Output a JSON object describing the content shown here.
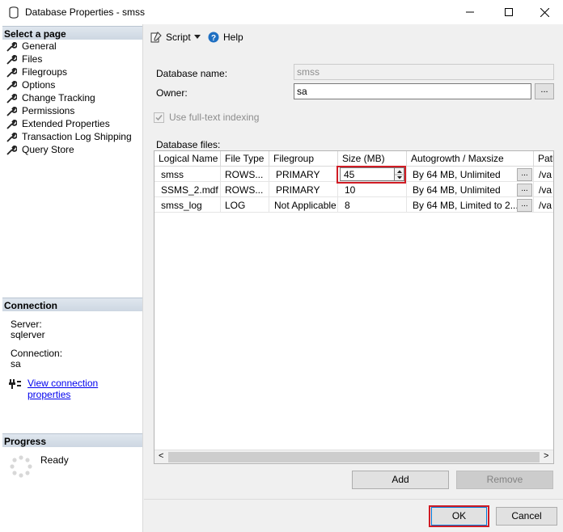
{
  "window": {
    "title": "Database Properties - smss",
    "minimize_glyph": "—",
    "maximize_glyph": "☐",
    "close_glyph": "✕"
  },
  "left_pane": {
    "select_page_header": "Select a page",
    "pages": [
      {
        "label": "General"
      },
      {
        "label": "Files",
        "selected": true
      },
      {
        "label": "Filegroups"
      },
      {
        "label": "Options"
      },
      {
        "label": "Change Tracking"
      },
      {
        "label": "Permissions"
      },
      {
        "label": "Extended Properties"
      },
      {
        "label": "Transaction Log Shipping"
      },
      {
        "label": "Query Store"
      }
    ],
    "connection_header": "Connection",
    "server_label": "Server:",
    "server_value": "sqlerver",
    "connection_label": "Connection:",
    "connection_value": "sa",
    "view_connection_link": "View connection properties",
    "progress_header": "Progress",
    "progress_status": "Ready"
  },
  "toolbar": {
    "script_label": "Script",
    "help_label": "Help"
  },
  "form": {
    "database_name_label": "Database name:",
    "database_name_value": "smss",
    "owner_label": "Owner:",
    "owner_value": "sa",
    "owner_browse": "...",
    "fulltext_label": "Use full-text indexing",
    "fulltext_checked": true,
    "database_files_label": "Database files:"
  },
  "files_grid": {
    "columns": [
      "Logical Name",
      "File Type",
      "Filegroup",
      "Size (MB)",
      "Autogrowth / Maxsize",
      "Path"
    ],
    "rows": [
      {
        "logical_name": "smss",
        "file_type": "ROWS...",
        "filegroup": "PRIMARY",
        "size": "45",
        "autogrowth": "By 64 MB, Unlimited",
        "btn": "...",
        "path": "/va"
      },
      {
        "logical_name": "SSMS_2.mdf",
        "file_type": "ROWS...",
        "filegroup": "PRIMARY",
        "size": "10",
        "autogrowth": "By 64 MB, Unlimited",
        "btn": "...",
        "path": "/va"
      },
      {
        "logical_name": "smss_log",
        "file_type": "LOG",
        "filegroup": "Not Applicable",
        "size": "8",
        "autogrowth": "By 64 MB, Limited to 2...",
        "btn": "...",
        "path": "/va"
      }
    ],
    "scroll_left": "<",
    "scroll_right": ">"
  },
  "buttons": {
    "add": "Add",
    "remove": "Remove",
    "ok": "OK",
    "cancel": "Cancel"
  },
  "colors": {
    "highlight_red": "#d01c25",
    "link_blue": "#0000ee",
    "help_blue": "#1e6fc2"
  }
}
